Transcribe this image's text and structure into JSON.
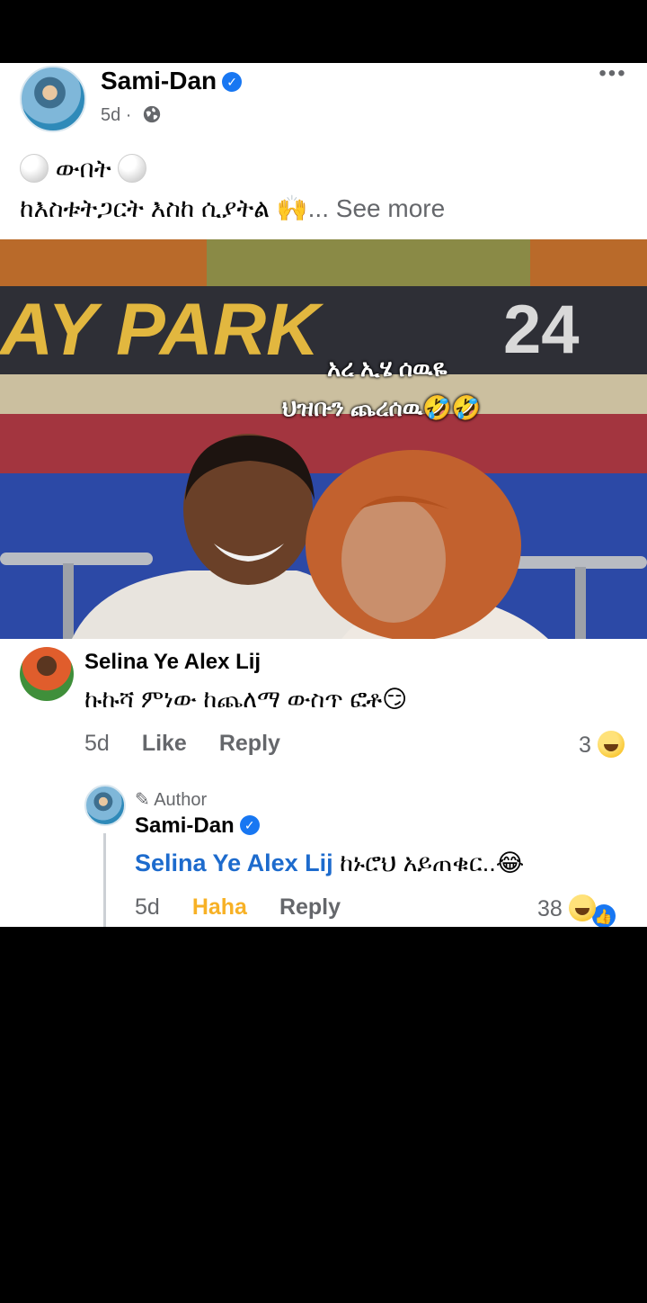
{
  "post": {
    "author": "Sami-Dan",
    "time": "5d",
    "caption_line1": "ውበት",
    "caption_line2": "ከእስቱትጋርት እስከ ሲያትል 🙌",
    "see_more": "... See more",
    "photo": {
      "sign_text": "AY PARK",
      "sign_number": "24",
      "overlay_line1": "አረ ኢሄ ሰዉዬ",
      "overlay_line2": "ህዝቡን ጨረሰዉ🤣🤣"
    }
  },
  "comments": [
    {
      "name": "Selina Ye Alex Lij",
      "text": "ኩኩሻ ምነው ከጨለማ ውስጥ ፎቶ😏",
      "time": "5d",
      "like_label": "Like",
      "reply_label": "Reply",
      "reaction_count": "3"
    }
  ],
  "reply": {
    "badge": "Author",
    "name": "Sami-Dan",
    "mention": "Selina Ye Alex Lij",
    "text": "ከኑሮህ አይጠቁር..😂",
    "time": "5d",
    "reaction_label": "Haha",
    "reply_label": "Reply",
    "reaction_count": "38"
  },
  "icons": {
    "verified": "verified-badge-icon",
    "globe": "globe-icon",
    "more": "more-options-icon",
    "pencil": "pencil-icon"
  },
  "colors": {
    "link_blue": "#1d6bcd",
    "haha_yellow": "#f7b125",
    "verified_blue": "#1877f2"
  }
}
